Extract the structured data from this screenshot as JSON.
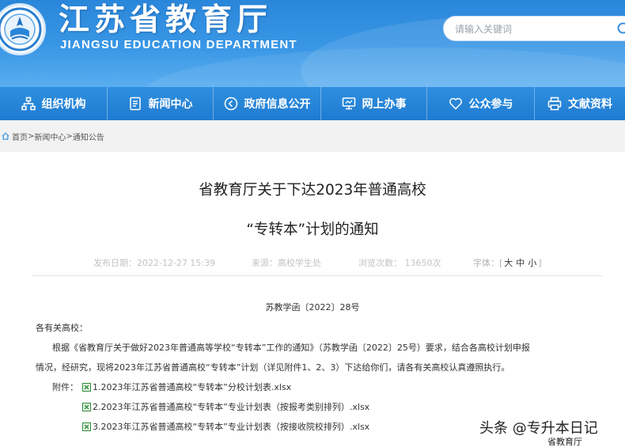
{
  "header": {
    "title": "江苏省教育厅",
    "subtitle": "JIANGSU EDUCATION DEPARTMENT",
    "logo_icon": "education-emblem-icon",
    "search": {
      "placeholder": "请输入关键词",
      "icon": "search-icon"
    }
  },
  "nav": {
    "items": [
      {
        "label": "组织机构",
        "icon": "org-chart-icon"
      },
      {
        "label": "新闻中心",
        "icon": "news-document-icon"
      },
      {
        "label": "政府信息公开",
        "icon": "play-circle-icon"
      },
      {
        "label": "网上办事",
        "icon": "monitor-icon"
      },
      {
        "label": "公众参与",
        "icon": "heart-icon"
      },
      {
        "label": "文献资料",
        "icon": "printer-icon"
      }
    ]
  },
  "breadcrumb": {
    "home": "首页",
    "sep": ">",
    "section": "新闻中心",
    "current": "通知公告"
  },
  "article": {
    "title_line1": "省教育厅关于下达2023年普通高校",
    "title_line2": "“专转本”计划的通知",
    "meta": {
      "date": "发布日期：2022-12-27 15:39",
      "source": "来源：高校学生处",
      "views": "浏览次数： 13650次",
      "font_label": "字体：[",
      "font_large": "大",
      "font_medium": "中",
      "font_small": "小",
      "font_end": "]"
    },
    "doc_number": "苏教学函〔2022〕28号",
    "addressee": "各有关高校：",
    "body_line1": "根据《省教育厅关于做好2023年普通高等学校“专转本”工作的通知》（苏教学函〔2022〕25号）要求，结合各高校计划申报",
    "body_line2": "情况，经研究，现将2023年江苏省普通高校“专转本”计划（详见附件1、2、3）下达给你们，请各有关高校认真遵照执行。",
    "attachments_label": "附件：",
    "attachments": [
      "1.2023年江苏省普通高校“专转本”分校计划表.xlsx",
      "2.2023年江苏省普通高校“专转本”专业计划表（按报考类别排列）.xlsx",
      "3.2023年江苏省普通高校“专转本”专业计划表（按接收院校排列）.xlsx"
    ],
    "attachment_icon": "excel-file-icon"
  },
  "watermark": {
    "main": "头条 @专升本日记",
    "sub": "省教育厅"
  },
  "colors": {
    "header_blue": "#2a86d9",
    "nav_blue": "#1f7bd0",
    "breadcrumb_bg": "#f2f2f2"
  }
}
